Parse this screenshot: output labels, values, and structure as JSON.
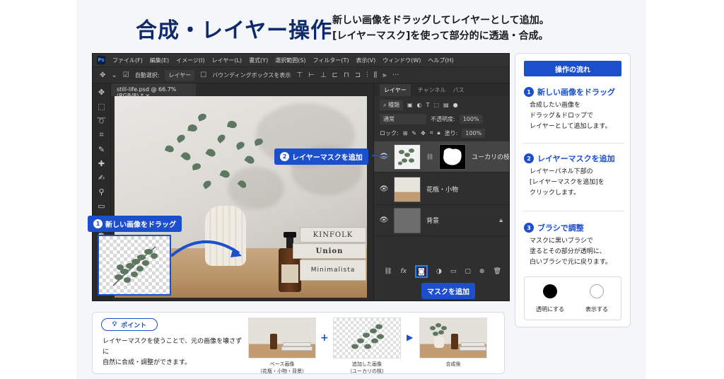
{
  "header": {
    "title": "合成・レイヤー操作",
    "lines": [
      "新しい画像をドラッグしてレイヤーとして追加。",
      "[レイヤーマスク]を使って部分的に透過・合成。"
    ]
  },
  "photoshop": {
    "logo": "Ps",
    "menu": [
      "ファイル(F)",
      "編集(E)",
      "イメージ(I)",
      "レイヤー(L)",
      "書式(Y)",
      "選択範囲(S)",
      "フィルター(T)",
      "表示(V)",
      "ウィンドウ(W)",
      "ヘルプ(H)"
    ],
    "options": {
      "auto_select": "自動選択:",
      "target": "レイヤー",
      "bounding_box": "バウンディングボックスを表示",
      "more": "···"
    },
    "doc_tab": "still-life.psd @ 66.7% (RGB/8) *",
    "panel_tabs": [
      "レイヤー",
      "チャンネル",
      "パス"
    ],
    "filter_kind": "種類",
    "blend_mode": "通常",
    "opacity_label": "不透明度:",
    "opacity_value": "100%",
    "lock_label": "ロック:",
    "fill_label": "塗り:",
    "fill_value": "100%",
    "layers": [
      {
        "name": "ユーカリの枝",
        "selected": true
      },
      {
        "name": "花瓶・小物",
        "selected": false
      },
      {
        "name": "背景",
        "selected": false
      }
    ],
    "footer_fx": "fx",
    "books": [
      "KINFOLK",
      "Union",
      "Minimalista"
    ]
  },
  "callouts": {
    "drag": {
      "num": "1",
      "label": "新しい画像をドラッグ"
    },
    "mask": {
      "num": "2",
      "label": "レイヤーマスクを追加"
    },
    "add_mask": "マスクを追加"
  },
  "steps": {
    "heading": "操作の流れ",
    "items": [
      {
        "num": "1",
        "title": "新しい画像をドラッグ",
        "body": [
          "合成したい画像を",
          "ドラッグ＆ドロップで",
          "レイヤーとして追加します。"
        ]
      },
      {
        "num": "2",
        "title": "レイヤーマスクを追加",
        "body": [
          "レイヤーパネル下部の",
          "[レイヤーマスクを追加]を",
          "クリックします。"
        ]
      },
      {
        "num": "3",
        "title": "ブラシで調整",
        "body": [
          "マスクに黒いブラシで",
          "塗るとその部分が透明に、",
          "白いブラシで元に戻ります。"
        ]
      }
    ],
    "brush_black": "透明にする",
    "brush_white": "表示する"
  },
  "point": {
    "tag": "ポイント",
    "text": [
      "レイヤーマスクを使うことで、元の画像を壊さずに",
      "自然に合成・調整ができます。"
    ],
    "examples": [
      {
        "caption1": "ベース画像",
        "caption2": "（花瓶・小物・背景）"
      },
      {
        "caption1": "追加した画像",
        "caption2": "（ユーカリの枝）"
      },
      {
        "caption1": "合成後",
        "caption2": ""
      }
    ],
    "plus": "+",
    "arrow": "▶"
  },
  "colors": {
    "accent": "#1b4fcc",
    "navy": "#0f2a6b",
    "ps_bg": "#2b2b2b"
  }
}
